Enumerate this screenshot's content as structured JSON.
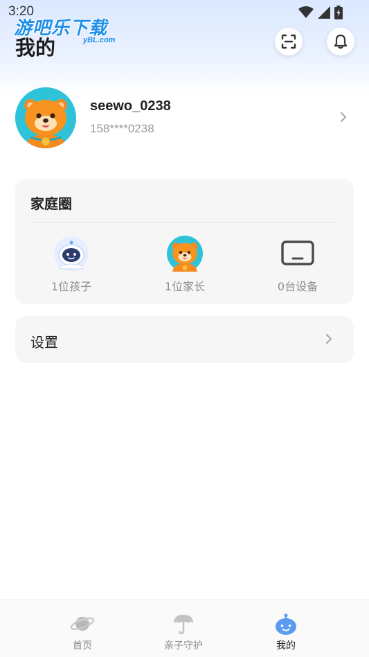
{
  "status_bar": {
    "time": "3:20"
  },
  "watermark": {
    "text": "游吧乐下载",
    "sub": "yBL.com"
  },
  "header": {
    "title": "我的",
    "scan_icon": "scan-icon",
    "bell_icon": "bell-icon"
  },
  "profile": {
    "username": "seewo_0238",
    "phone": "158****0238",
    "avatar_icon": "bear-avatar-icon"
  },
  "family_circle": {
    "title": "家庭圈",
    "items": [
      {
        "label": "1位孩子",
        "icon": "astronaut-icon"
      },
      {
        "label": "1位家长",
        "icon": "bear-avatar-icon"
      },
      {
        "label": "0台设备",
        "icon": "tablet-icon"
      }
    ]
  },
  "settings": {
    "label": "设置"
  },
  "bottom_nav": {
    "items": [
      {
        "label": "首页",
        "icon": "planet-icon"
      },
      {
        "label": "亲子守护",
        "icon": "umbrella-icon"
      },
      {
        "label": "我的",
        "icon": "robot-face-icon",
        "active": true
      }
    ]
  },
  "colors": {
    "accent": "#5b9bf0",
    "card_bg": "#f6f6f7",
    "avatar_bg": "#2fc3d9",
    "header_gradient_top": "#dbe8ff"
  }
}
